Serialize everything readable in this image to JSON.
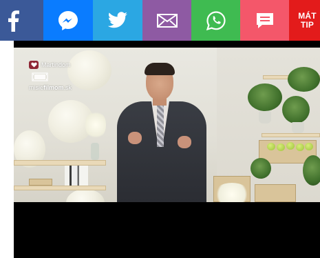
{
  "share_bar": {
    "buttons": [
      {
        "name": "facebook",
        "color": "#3b5998",
        "icon": "facebook-icon"
      },
      {
        "name": "messenger",
        "color": "#0a7cff",
        "icon": "messenger-icon"
      },
      {
        "name": "twitter",
        "color": "#2ba7e3",
        "icon": "twitter-icon"
      },
      {
        "name": "email",
        "color": "#8e5aa3",
        "icon": "mail-icon"
      },
      {
        "name": "whatsapp",
        "color": "#3fbb51",
        "icon": "whatsapp-icon"
      },
      {
        "name": "sms",
        "color": "#f4576a",
        "icon": "message-icon"
      },
      {
        "name": "tip",
        "color": "#e31b1b",
        "line1": "MÁT",
        "line2": "TIP"
      }
    ]
  },
  "video": {
    "watermark": {
      "brand": "Martindom",
      "site_prefix": "misie",
      "site_bold": "filmom",
      "site_suffix": ".sk"
    }
  }
}
